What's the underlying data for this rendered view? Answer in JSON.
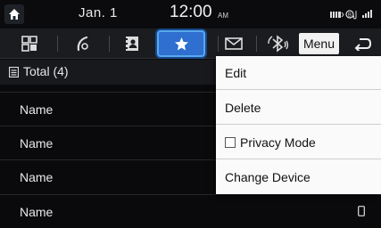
{
  "status": {
    "date": "Jan.  1",
    "time": "12:00",
    "ampm": "AM"
  },
  "toolbar": {
    "menu_label": "Menu",
    "selected_tab": "favorites"
  },
  "list": {
    "header": "Total (4)",
    "rows": [
      "Name",
      "Name",
      "Name",
      "Name"
    ]
  },
  "dropdown": {
    "items": [
      "Edit",
      "Delete",
      "Privacy Mode",
      "Change Device"
    ]
  },
  "colors": {
    "accent": "#2e6fcf",
    "background": "#0a0a0c",
    "menu_bg": "#fafafa"
  }
}
